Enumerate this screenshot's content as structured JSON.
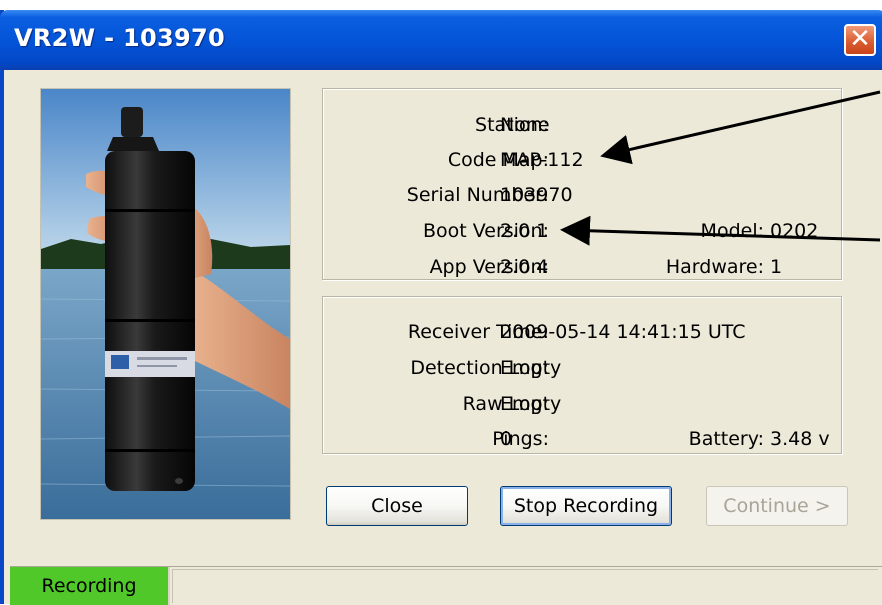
{
  "window": {
    "title": "VR2W - 103970",
    "close_glyph": "✕"
  },
  "info": {
    "station_label": "Station:",
    "station_value": "None",
    "codemap_label": "Code Map:",
    "codemap_value": "MAP-112",
    "serial_label": "Serial Number:",
    "serial_value": "103970",
    "boot_label": "Boot Version:",
    "boot_value": "2.0.1",
    "model_label": "Model:",
    "model_value": "0202",
    "app_label": "App Version:",
    "app_value": "2.0.4",
    "hardware_label": "Hardware:",
    "hardware_value": "1"
  },
  "status": {
    "time_label": "Receiver Time:",
    "time_value": "2009-05-14  14:41:15  UTC",
    "detection_label": "Detection Log:",
    "detection_value": "Empty",
    "raw_label": "Raw Log:",
    "raw_value": "Empty",
    "pings_label": "Pings:",
    "pings_value": "0",
    "battery_label": "Battery:",
    "battery_value": "3.48 v"
  },
  "buttons": {
    "close": "Close",
    "stop": "Stop Recording",
    "continue": "Continue >"
  },
  "statusbar": {
    "state": "Recording"
  },
  "icons": {
    "close": "close-icon",
    "photo": "receiver-photo",
    "arrow": "arrow-annotation"
  },
  "colors": {
    "titlebar": "#0453d6",
    "recording": "#50c829",
    "close_button": "#d95a2e"
  }
}
